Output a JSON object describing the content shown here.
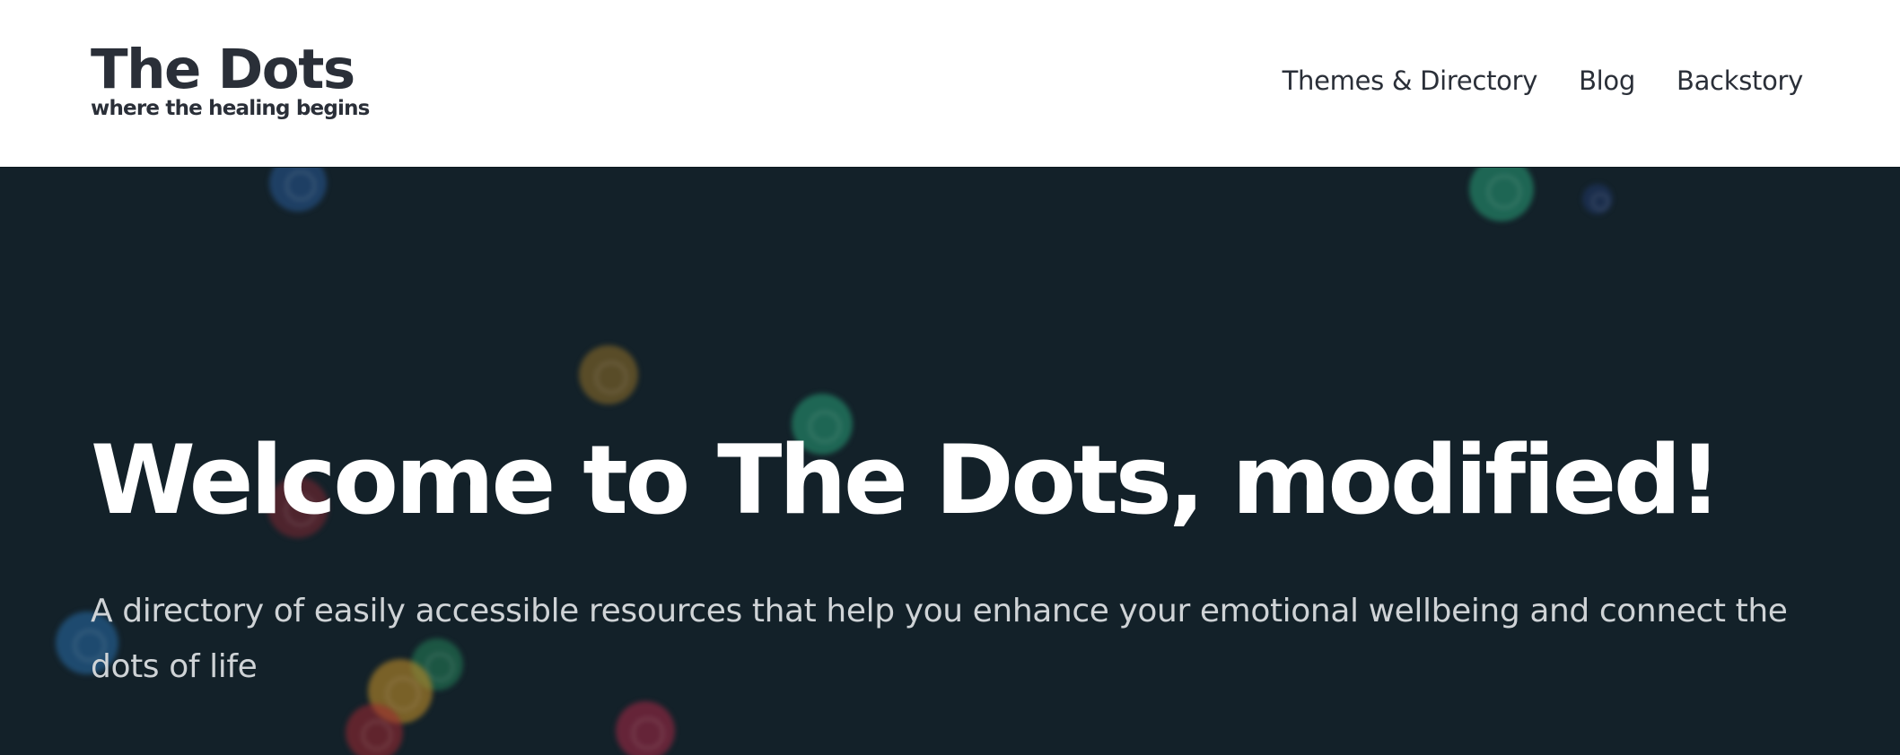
{
  "header": {
    "site_title": "The Dots",
    "tagline": "where the healing begins",
    "nav": [
      {
        "label": "Themes & Directory"
      },
      {
        "label": "Blog"
      },
      {
        "label": "Backstory"
      }
    ]
  },
  "hero": {
    "title": "Welcome to The Dots, modified!",
    "subtitle": "A directory of easily accessible resources that help you enhance your emotional wellbeing and connect the dots of life",
    "background_color": "#132129",
    "decorative_dots": "bokeh-circles"
  },
  "colors": {
    "header_bg": "#ffffff",
    "text_dark": "#2a2f38",
    "hero_bg": "#132129",
    "hero_title": "#ffffff",
    "hero_subtitle": "#cfd3d6"
  }
}
